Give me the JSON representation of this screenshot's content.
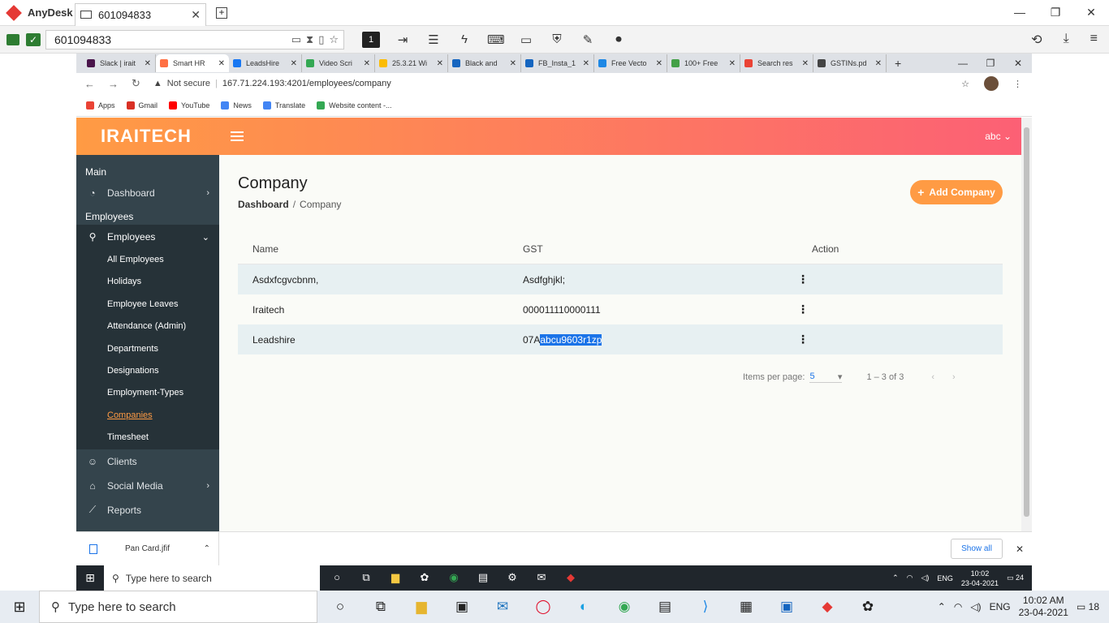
{
  "anydesk": {
    "app_name": "AnyDesk",
    "tab_label": "601094833",
    "address": "601094833"
  },
  "browser": {
    "tabs": [
      {
        "label": "Slack | irait",
        "color": "#4a154b"
      },
      {
        "label": "Smart HR",
        "color": "#ff7043",
        "active": true
      },
      {
        "label": "LeadsHire",
        "color": "#1877f2"
      },
      {
        "label": "Video Scri",
        "color": "#34a853"
      },
      {
        "label": "25.3.21 Wi",
        "color": "#fbbc04"
      },
      {
        "label": "Black and",
        "color": "#1565c0"
      },
      {
        "label": "FB_Insta_1",
        "color": "#1565c0"
      },
      {
        "label": "Free Vecto",
        "color": "#1e88e5"
      },
      {
        "label": "100+ Free",
        "color": "#43a047"
      },
      {
        "label": "Search res",
        "color": "#ea4335"
      },
      {
        "label": "GSTINs.pd",
        "color": "#444444"
      }
    ],
    "not_secure": "Not secure",
    "url": "167.71.224.193:4201/employees/company",
    "bookmarks": [
      "Apps",
      "Gmail",
      "YouTube",
      "News",
      "Translate",
      "Website content -..."
    ]
  },
  "app": {
    "logo": "IRAITECH",
    "user": "abc",
    "colors": {
      "gradient_start": "#ff9b44",
      "gradient_end": "#fc6075",
      "sidebar": "#34444c",
      "accent": "#ff9b44"
    },
    "sidebar": {
      "main_title": "Main",
      "dashboard": "Dashboard",
      "employees_title": "Employees",
      "employees": "Employees",
      "sub": [
        "All Employees",
        "Holidays",
        "Employee Leaves",
        "Attendance (Admin)",
        "Departments",
        "Designations",
        "Employment-Types",
        "Companies",
        "Timesheet"
      ],
      "clients": "Clients",
      "social_media": "Social Media",
      "reports": "Reports"
    },
    "page": {
      "title": "Company",
      "breadcrumb_home": "Dashboard",
      "breadcrumb_sep": "/",
      "breadcrumb_current": "Company",
      "add_button": "Add Company"
    },
    "table": {
      "headers": [
        "Name",
        "GST",
        "Action"
      ],
      "rows": [
        {
          "name": "Asdxfcgvcbnm,",
          "gst": "Asdfghjkl;"
        },
        {
          "name": "Iraitech",
          "gst": "000011110000111"
        },
        {
          "name": "Leadshire",
          "gst_prefix": "07A",
          "gst_selected": "abcu9603r1zp"
        }
      ]
    },
    "pager": {
      "label": "Items per page:",
      "size": "5",
      "range": "1 – 3 of 3"
    }
  },
  "downloads": {
    "file": "Pan Card.jfif",
    "show_all": "Show all"
  },
  "inner_taskbar": {
    "search": "Type here to search",
    "time": "10:02",
    "date": "23-04-2021",
    "lang": "ENG",
    "notif": "24"
  },
  "outer_taskbar": {
    "search": "Type here to search",
    "time": "10:02 AM",
    "date": "23-04-2021",
    "lang": "ENG",
    "notif": "18"
  }
}
